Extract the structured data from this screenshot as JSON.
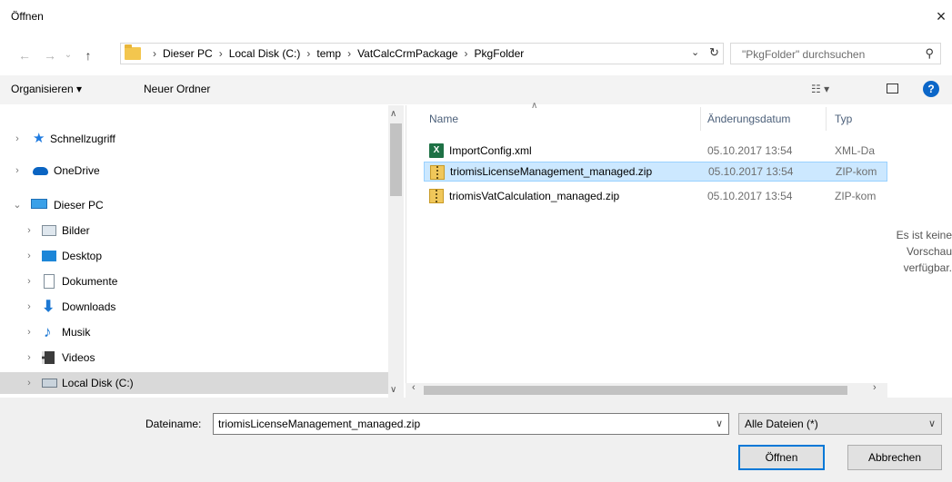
{
  "window": {
    "title": "Öffnen",
    "close_label": "×"
  },
  "nav": {
    "back": "←",
    "forward": "→",
    "recent": "⌄",
    "up": "↑"
  },
  "address": {
    "crumbs": [
      "Dieser PC",
      "Local Disk (C:)",
      "temp",
      "VatCalcCrmPackage",
      "PkgFolder"
    ],
    "separator": "›",
    "refresh": "↻",
    "dropdown": "⌄"
  },
  "search": {
    "placeholder": "\"PkgFolder\" durchsuchen",
    "icon": "⚲"
  },
  "toolbar": {
    "organize_label": "Organisieren ▾",
    "new_folder_label": "Neuer Ordner",
    "view_label": "☷ ▾",
    "help_label": "?"
  },
  "sidebar": {
    "items": [
      {
        "label": "Schnellzugriff",
        "icon": "star-icon",
        "expanded": false
      },
      {
        "label": "OneDrive",
        "icon": "cloud-icon",
        "expanded": false
      },
      {
        "label": "Dieser PC",
        "icon": "computer-icon",
        "expanded": true
      },
      {
        "label": "Bilder",
        "icon": "pictures-icon",
        "expanded": false
      },
      {
        "label": "Desktop",
        "icon": "desktop-icon",
        "expanded": false
      },
      {
        "label": "Dokumente",
        "icon": "documents-icon",
        "expanded": false
      },
      {
        "label": "Downloads",
        "icon": "download-icon",
        "expanded": false
      },
      {
        "label": "Musik",
        "icon": "music-icon",
        "expanded": false
      },
      {
        "label": "Videos",
        "icon": "video-icon",
        "expanded": false
      },
      {
        "label": "Local Disk (C:)",
        "icon": "drive-icon",
        "expanded": false,
        "selected": true
      }
    ]
  },
  "filelist": {
    "columns": {
      "name": "Name",
      "date": "Änderungsdatum",
      "type": "Typ"
    },
    "rows": [
      {
        "name": "ImportConfig.xml",
        "date": "05.10.2017 13:54",
        "type": "XML-Da",
        "icon": "excel-xml-icon",
        "selected": false
      },
      {
        "name": "triomisLicenseManagement_managed.zip",
        "date": "05.10.2017 13:54",
        "type": "ZIP-kom",
        "icon": "zip-icon",
        "selected": true
      },
      {
        "name": "triomisVatCalculation_managed.zip",
        "date": "05.10.2017 13:54",
        "type": "ZIP-kom",
        "icon": "zip-icon",
        "selected": false
      }
    ]
  },
  "preview": {
    "line1": "Es ist keine",
    "line2": "Vorschau",
    "line3": "verfügbar."
  },
  "footer": {
    "filename_label": "Dateiname:",
    "filename_value": "triomisLicenseManagement_managed.zip",
    "filter_value": "Alle Dateien (*)",
    "open_label": "Öffnen",
    "cancel_label": "Abbrechen"
  },
  "colors": {
    "accent": "#0078d7",
    "selection": "#cce8ff",
    "help": "#0b66c8"
  }
}
